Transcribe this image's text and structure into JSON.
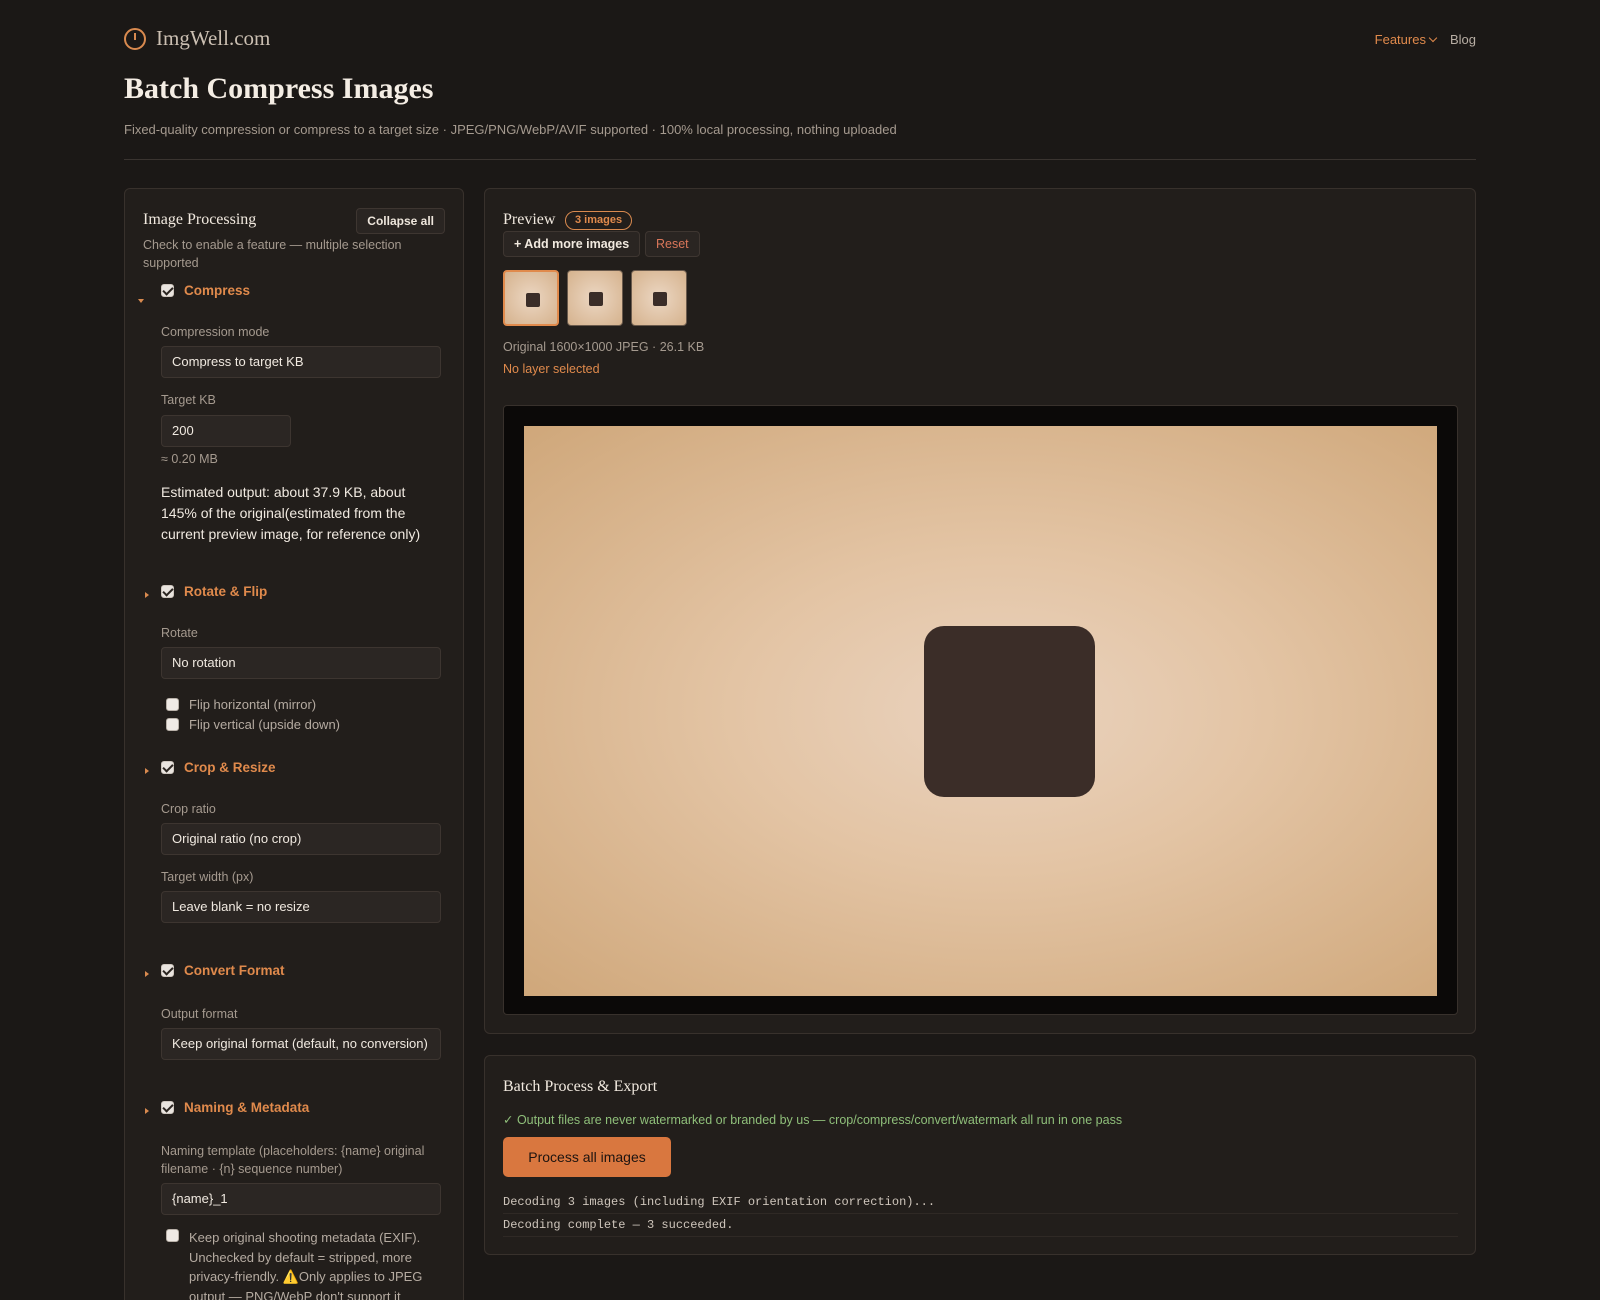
{
  "header": {
    "brand": "ImgWell.com",
    "nav": {
      "features": "Features",
      "blog": "Blog"
    }
  },
  "page": {
    "title": "Batch Compress Images",
    "subtitle": "Fixed-quality compression or compress to a target size · JPEG/PNG/WebP/AVIF supported · 100% local processing, nothing uploaded"
  },
  "panel": {
    "title": "Image Processing",
    "collapse_all": "Collapse all",
    "hint": "Check to enable a feature — multiple selection supported",
    "compress": {
      "label": "Compress",
      "enabled": true,
      "mode_label": "Compression mode",
      "mode_value": "Compress to target KB",
      "target_label": "Target KB",
      "target_value": "200",
      "target_mb": "≈ 0.20 MB",
      "estimate": "Estimated output: about 37.9 KB, about 145% of the original(estimated from the current preview image, for reference only)"
    },
    "rotate": {
      "label": "Rotate & Flip",
      "enabled": true,
      "rotate_label": "Rotate",
      "rotate_value": "No rotation",
      "flip_h": "Flip horizontal (mirror)",
      "flip_v": "Flip vertical (upside down)"
    },
    "crop": {
      "label": "Crop & Resize",
      "enabled": true,
      "ratio_label": "Crop ratio",
      "ratio_value": "Original ratio (no crop)",
      "width_label": "Target width (px)",
      "width_placeholder": "Leave blank = no resize"
    },
    "convert": {
      "label": "Convert Format",
      "enabled": true,
      "format_label": "Output format",
      "format_value": "Keep original format (default, no conversion)"
    },
    "naming": {
      "label": "Naming & Metadata",
      "enabled": true,
      "template_label": "Naming template (placeholders: {name} original filename · {n} sequence number)",
      "template_value": "{name}_1",
      "exif_label": "Keep original shooting metadata (EXIF). Unchecked by default = stripped, more privacy-friendly. ⚠️Only applies to JPEG output — PNG/WebP don't support it"
    }
  },
  "preview": {
    "title": "Preview",
    "count_badge": "3 images",
    "add_more": "+ Add more images",
    "reset": "Reset",
    "original_info": "Original 1600×1000 JPEG · 26.1 KB",
    "layer_status": "No layer selected"
  },
  "batch": {
    "title": "Batch Process & Export",
    "note": "✓ Output files are never watermarked or branded by us — crop/compress/convert/watermark all run in one pass",
    "process_button": "Process all images",
    "log": [
      "Decoding 3 images (including EXIF orientation correction)...",
      "Decoding complete — 3 succeeded."
    ]
  },
  "colors": {
    "accent": "#e08a4c",
    "background": "#1b1816",
    "panel": "#221e1b",
    "success": "#8fbf7a",
    "danger": "#d9765a"
  },
  "icons": {
    "brand": "clock-logo-icon",
    "features_dropdown": "chevron-down-icon"
  }
}
